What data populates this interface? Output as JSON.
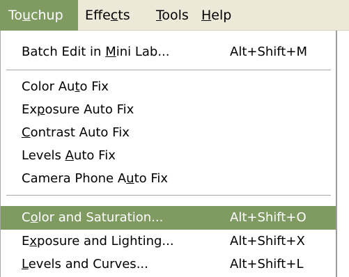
{
  "menubar": {
    "items": [
      {
        "pre": "To",
        "acc": "u",
        "post": "chup"
      },
      {
        "pre": "Effe",
        "acc": "c",
        "post": "ts"
      },
      {
        "pre": "",
        "acc": "T",
        "post": "ools"
      },
      {
        "pre": "",
        "acc": "H",
        "post": "elp"
      }
    ]
  },
  "menu": {
    "items": [
      {
        "pre": "Batch Edit in ",
        "acc": "M",
        "post": "ini Lab...",
        "shortcut": "Alt+Shift+M"
      },
      {
        "pre": "Color Au",
        "acc": "t",
        "post": "o Fix",
        "shortcut": ""
      },
      {
        "pre": "Ex",
        "acc": "p",
        "post": "osure Auto Fix",
        "shortcut": ""
      },
      {
        "pre": "",
        "acc": "C",
        "post": "ontrast Auto Fix",
        "shortcut": ""
      },
      {
        "pre": "Levels ",
        "acc": "A",
        "post": "uto Fix",
        "shortcut": ""
      },
      {
        "pre": "Camera Phone A",
        "acc": "u",
        "post": "to Fix",
        "shortcut": ""
      },
      {
        "pre": "C",
        "acc": "o",
        "post": "lor and Saturation...",
        "shortcut": "Alt+Shift+O"
      },
      {
        "pre": "E",
        "acc": "x",
        "post": "posure and Lighting...",
        "shortcut": "Alt+Shift+X"
      },
      {
        "pre": "",
        "acc": "L",
        "post": "evels and Curves...",
        "shortcut": "Alt+Shift+L"
      }
    ]
  },
  "colors": {
    "highlight": "#7f9b62",
    "menubar_bg": "#ece9d8"
  }
}
